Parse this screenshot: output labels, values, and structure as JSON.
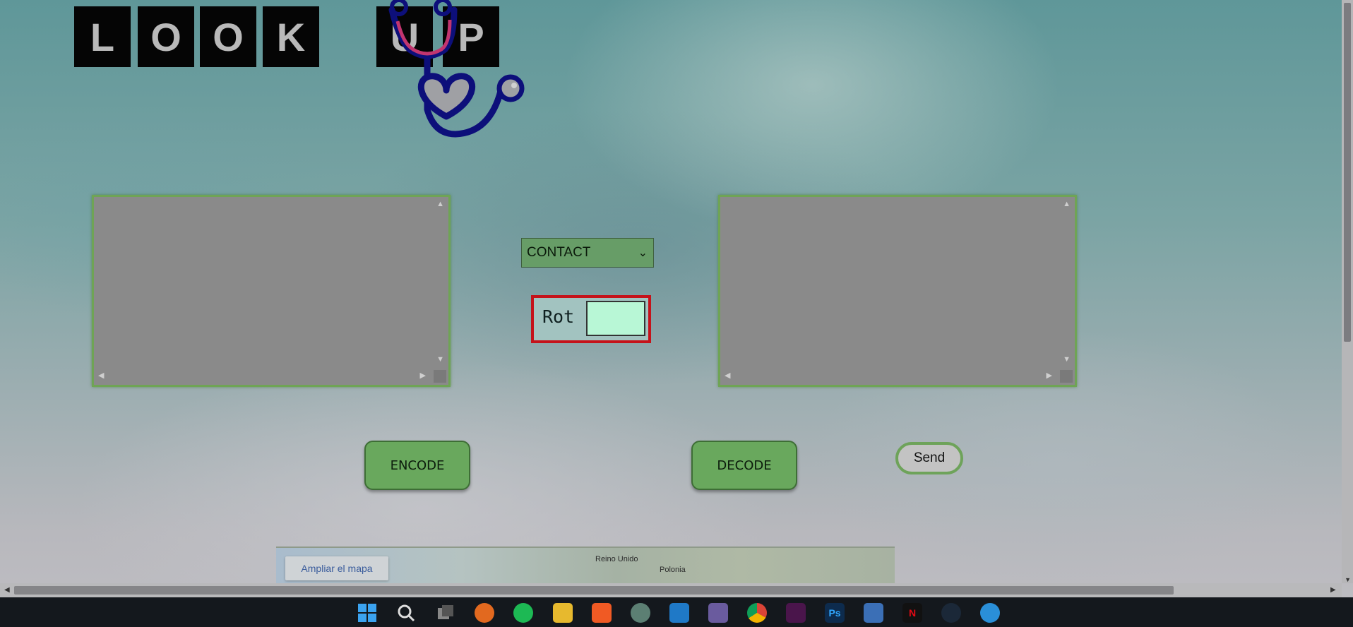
{
  "logo": {
    "letters": [
      "L",
      "O",
      "O",
      "K",
      "U",
      "P"
    ]
  },
  "converter": {
    "input_text": "",
    "output_text": "",
    "mode_select": {
      "selected": "CONTACT"
    },
    "rot": {
      "label": "Rot",
      "value": ""
    }
  },
  "buttons": {
    "encode": "ENCODE",
    "decode": "DECODE",
    "send": "Send"
  },
  "map": {
    "expand_link": "Ampliar el mapa",
    "labels": {
      "uk": "Reino Unido",
      "poland": "Polonia"
    }
  },
  "taskbar": {
    "apps": [
      "start-icon",
      "search-icon",
      "task-view-icon",
      "crunchyroll-icon",
      "spotify-icon",
      "file-explorer-icon",
      "brave-icon",
      "chatgpt-icon",
      "vscode-icon",
      "git-icon",
      "chrome-icon",
      "slack-icon",
      "photoshop-icon",
      "store-icon",
      "netflix-icon",
      "steam-icon",
      "browser-icon"
    ]
  },
  "colors": {
    "textarea_border": "#6fa455",
    "button_green": "#69a85d",
    "rot_border": "#c5121a",
    "rot_input": "#b8f7d6"
  }
}
